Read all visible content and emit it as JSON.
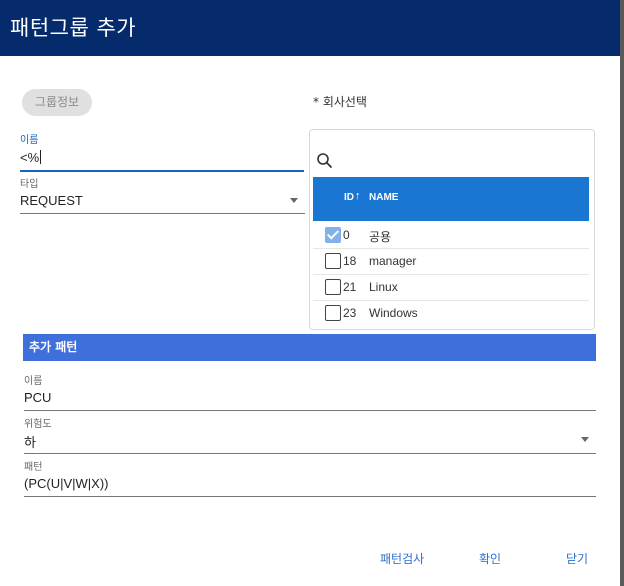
{
  "dialog": {
    "title": "패턴그룹 추가"
  },
  "group": {
    "chip_label": "그룹정보",
    "name_label": "이름",
    "name_value": "<%",
    "type_label": "타입",
    "type_value": "REQUEST"
  },
  "company": {
    "label": "* 회사선택",
    "columns": {
      "id": "ID",
      "name": "NAME"
    },
    "rows": [
      {
        "id": "0",
        "name": "공용",
        "checked": true
      },
      {
        "id": "18",
        "name": "manager",
        "checked": false
      },
      {
        "id": "21",
        "name": "Linux",
        "checked": false
      },
      {
        "id": "23",
        "name": "Windows",
        "checked": false
      }
    ]
  },
  "pattern": {
    "section_title": "추가 패턴",
    "name_label": "이름",
    "name_value": "PCU",
    "risk_label": "위험도",
    "risk_value": "하",
    "pattern_label": "패턴",
    "pattern_value": "(PC(U|V|W|X))"
  },
  "actions": {
    "check": "패턴검사",
    "confirm": "확인",
    "close": "닫기"
  },
  "colors": {
    "titlebar": "#062b6c",
    "table_header": "#1976d2",
    "section": "#3f6fdb",
    "focus": "#1565c0",
    "checked": "#82b1e8",
    "button_text": "#2a6fcf"
  }
}
